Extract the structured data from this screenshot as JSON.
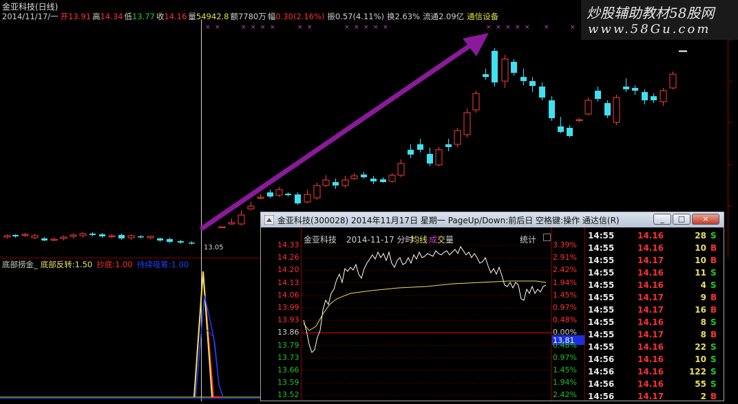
{
  "main": {
    "title": "金亚科技(日线)",
    "quote": [
      {
        "t": "2014/11/17/一",
        "c": "#d0d0d0"
      },
      {
        "t": "开",
        "c": "#ff3030"
      },
      {
        "t": "13.91",
        "c": "#ff3030"
      },
      {
        "t": "高",
        "c": "#d0d0d0"
      },
      {
        "t": "14.34",
        "c": "#ff3030"
      },
      {
        "t": "低",
        "c": "#d0d0d0"
      },
      {
        "t": "13.77",
        "c": "#20d020"
      },
      {
        "t": "收",
        "c": "#d0d0d0"
      },
      {
        "t": "14.16",
        "c": "#ff3030"
      },
      {
        "t": "量",
        "c": "#d0d0d0"
      },
      {
        "t": "54942.8",
        "c": "#e0e040"
      },
      {
        "t": "额",
        "c": "#d0d0d0"
      },
      {
        "t": "7780万",
        "c": "#d0d0d0"
      },
      {
        "t": "幅",
        "c": "#d0d0d0"
      },
      {
        "t": "0.30(2.16%)",
        "c": "#ff3030"
      },
      {
        "t": "振",
        "c": "#d0d0d0"
      },
      {
        "t": "0.57(4.11%)",
        "c": "#d0d0d0"
      },
      {
        "t": "换",
        "c": "#d0d0d0"
      },
      {
        "t": "2.63%",
        "c": "#d0d0d0"
      },
      {
        "t": "流通",
        "c": "#d0d0d0"
      },
      {
        "t": "2.09亿",
        "c": "#d0d0d0"
      },
      {
        "t": "通信设备",
        "c": "#e0e040"
      }
    ],
    "low_label": "13.05",
    "watermark_line1": "炒股辅助教材58股网",
    "watermark_line2": "www.58Gu.com"
  },
  "indicator": {
    "items": [
      {
        "t": "底部捞金_",
        "c": "#d0d0d0"
      },
      {
        "t": "底部反转:",
        "c": "#e8e060"
      },
      {
        "t": "1.50",
        "c": "#e8e060"
      },
      {
        "t": "抄底:",
        "c": "#ff3030"
      },
      {
        "t": "1.00",
        "c": "#ff3030"
      },
      {
        "t": "持续吸筹:",
        "c": "#2040ff"
      },
      {
        "t": "1.00",
        "c": "#2040ff"
      }
    ]
  },
  "window": {
    "title": "金亚科技(300028) 2014年11月17日 星期一 PageUp/Down:前后日 空格键:操作 通达信(R)",
    "btn_min": "_",
    "btn_max": "□",
    "btn_close": "×",
    "header": {
      "name": "金亚科技",
      "date": "2014-11-17 分时",
      "legend_avg": "均线",
      "legend_vol_1": "成",
      "legend_vol_2": "交",
      "legend_vol_3": "量",
      "stats": "统计"
    },
    "price_labels": [
      {
        "t": "14.33",
        "c": "#ff3030"
      },
      {
        "t": "14.26",
        "c": "#ff3030"
      },
      {
        "t": "14.20",
        "c": "#ff3030"
      },
      {
        "t": "14.13",
        "c": "#ff3030"
      },
      {
        "t": "14.06",
        "c": "#ff3030"
      },
      {
        "t": "13.99",
        "c": "#ff3030"
      },
      {
        "t": "13.93",
        "c": "#ff3030"
      },
      {
        "t": "13.86",
        "c": "#d0d0d0"
      },
      {
        "t": "13.79",
        "c": "#20c020"
      },
      {
        "t": "13.73",
        "c": "#20c020"
      },
      {
        "t": "13.66",
        "c": "#20c020"
      },
      {
        "t": "13.59",
        "c": "#20c020"
      },
      {
        "t": "13.52",
        "c": "#20c020"
      }
    ],
    "pct_labels": [
      {
        "t": "3.39%",
        "c": "#ff3030"
      },
      {
        "t": "2.91%",
        "c": "#ff3030"
      },
      {
        "t": "2.42%",
        "c": "#ff3030"
      },
      {
        "t": "1.94%",
        "c": "#ff3030"
      },
      {
        "t": "1.45%",
        "c": "#ff3030"
      },
      {
        "t": "0.97%",
        "c": "#ff3030"
      },
      {
        "t": "0.48%",
        "c": "#ff3030"
      },
      {
        "t": "0.00%",
        "c": "#d0d0d0"
      },
      {
        "t": "0.48%",
        "c": "#20c020"
      },
      {
        "t": "0.97%",
        "c": "#20c020"
      },
      {
        "t": "1.45%",
        "c": "#20c020"
      },
      {
        "t": "1.94%",
        "c": "#20c020"
      },
      {
        "t": "2.42%",
        "c": "#20c020"
      }
    ],
    "current_price": "13.81"
  },
  "ticks": [
    {
      "time": "14:55",
      "price": "14.16",
      "vol": "28",
      "side": "S"
    },
    {
      "time": "14:55",
      "price": "14.16",
      "vol": "10",
      "side": "B"
    },
    {
      "time": "14:55",
      "price": "14.17",
      "vol": "10",
      "side": "B"
    },
    {
      "time": "14:55",
      "price": "14.16",
      "vol": "11",
      "side": "S"
    },
    {
      "time": "14:55",
      "price": "14.16",
      "vol": "4",
      "side": "S"
    },
    {
      "time": "14:55",
      "price": "14.17",
      "vol": "9",
      "side": "B"
    },
    {
      "time": "14:55",
      "price": "14.17",
      "vol": "16",
      "side": "B"
    },
    {
      "time": "14:55",
      "price": "14.16",
      "vol": "8",
      "side": "S"
    },
    {
      "time": "14:55",
      "price": "14.17",
      "vol": "8",
      "side": "B"
    },
    {
      "time": "14:55",
      "price": "14.16",
      "vol": "22",
      "side": "S"
    },
    {
      "time": "14:56",
      "price": "14.16",
      "vol": "10",
      "side": "S"
    },
    {
      "time": "14:56",
      "price": "14.16",
      "vol": "122",
      "side": "S"
    },
    {
      "time": "14:56",
      "price": "14.16",
      "vol": "55",
      "side": "S"
    },
    {
      "time": "14:56",
      "price": "14.17",
      "vol": "2",
      "side": "B"
    }
  ],
  "colors": {
    "up": "#ff3c3c",
    "down": "#40e0f0",
    "grid": "#6a0000",
    "arrow": "#8a1a9a",
    "marker": "#d040d0"
  }
}
